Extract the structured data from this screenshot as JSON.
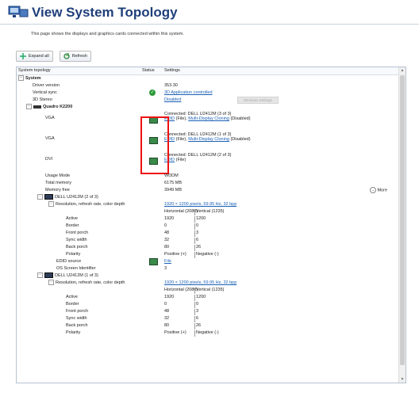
{
  "header": {
    "title": "View System Topology",
    "description": "This page shows the displays and graphics cards connected within this system."
  },
  "toolbar": {
    "expand_label": "Expand all",
    "refresh_label": "Refresh"
  },
  "table": {
    "col_topology": "System topology",
    "col_status": "Status",
    "col_settings": "Settings"
  },
  "system": {
    "label": "System",
    "driver_version_label": "Driver version",
    "driver_version": "353.30",
    "vsync_label": "Vertical sync",
    "vsync_value": "3D Application controlled",
    "stereo_label": "3D Stereo",
    "stereo_value": "Disabled"
  },
  "gpu": {
    "label": "Quadro K2200",
    "outputs": [
      {
        "label": "VGA",
        "line1": "Connected: DELL U2412M (3 of 3)",
        "edid": "EDID",
        "file": "(File),",
        "clone": "Multi-Display Cloning",
        "state": "(Disabled)"
      },
      {
        "label": "VGA",
        "line1": "Connected: DELL U2412M (1 of 3)",
        "edid": "EDID",
        "file": "(File),",
        "clone": "Multi-Display Cloning",
        "state": "(Disabled)"
      },
      {
        "label": "DVI",
        "line1": "Connected: DELL U2412M (2 of 3)",
        "edid": "EDID",
        "file": "(File)",
        "clone": "",
        "state": ""
      }
    ],
    "dim_button": "Windows Settings",
    "usage_mode_label": "Usage Mode",
    "usage_mode": "WDDM",
    "total_mem_label": "Total memory",
    "total_mem": "6175 MB",
    "free_mem_label": "Memory free",
    "free_mem": "3949 MB",
    "more_label": "More"
  },
  "displays": [
    {
      "label": "DELL U2412M (2 of 3)",
      "res_label": "Resolution, refresh rate, color depth",
      "res_value": "1920 × 1200 pixels, 59.95 Hz, 32 bpp",
      "h_head": "Horizontal (2080)",
      "v_head": "Vertical (1235)",
      "rows": [
        {
          "label": "Active",
          "h": "1920",
          "v": "1200"
        },
        {
          "label": "Border",
          "h": "0",
          "v": "0"
        },
        {
          "label": "Front porch",
          "h": "48",
          "v": "3"
        },
        {
          "label": "Sync width",
          "h": "32",
          "v": "6"
        },
        {
          "label": "Back porch",
          "h": "80",
          "v": "26"
        },
        {
          "label": "Polarity",
          "h": "Positive (+)",
          "v": "Negative (-)"
        }
      ],
      "edid_label": "EDID source",
      "edid_value": "File",
      "os_id_label": "OS Screen Identifier",
      "os_id_value": "3"
    },
    {
      "label": "DELL U2412M (1 of 3)",
      "res_label": "Resolution, refresh rate, color depth",
      "res_value": "1920 × 1200 pixels, 59.95 Hz, 32 bpp",
      "h_head": "Horizontal (2080)",
      "v_head": "Vertical (1235)",
      "rows": [
        {
          "label": "Active",
          "h": "1920",
          "v": "1200"
        },
        {
          "label": "Border",
          "h": "0",
          "v": "0"
        },
        {
          "label": "Front porch",
          "h": "48",
          "v": "3"
        },
        {
          "label": "Sync width",
          "h": "32",
          "v": "6"
        },
        {
          "label": "Back porch",
          "h": "80",
          "v": "26"
        },
        {
          "label": "Polarity",
          "h": "Positive (+)",
          "v": "Negative (-)"
        }
      ]
    }
  ]
}
